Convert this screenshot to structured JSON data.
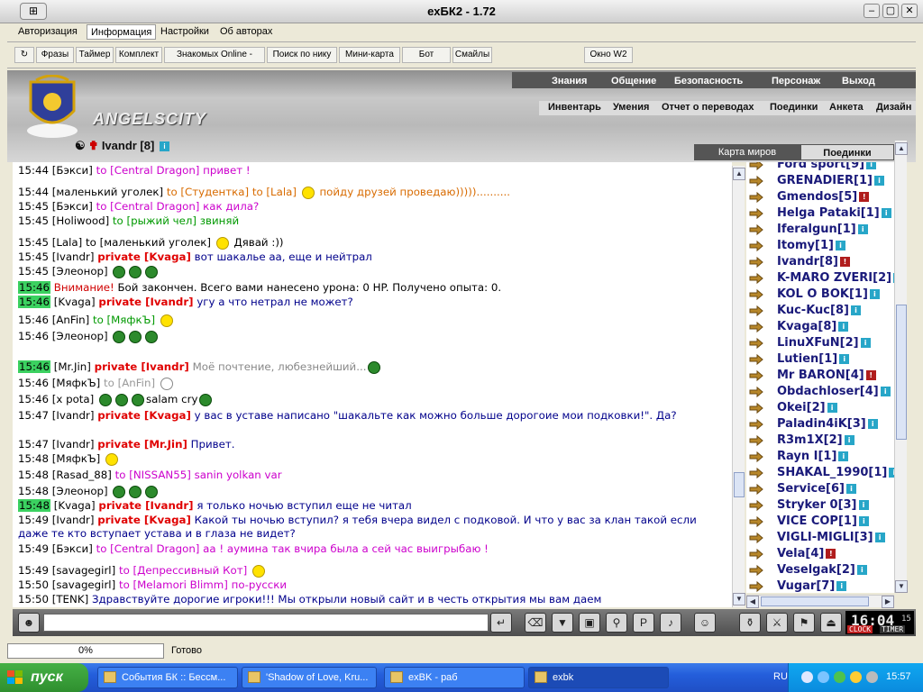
{
  "window": {
    "title": "exБК2 - 1.72"
  },
  "menu": [
    "Авторизация",
    "Информация",
    "Настройки",
    "Об авторах"
  ],
  "toolbar": [
    "Фразы",
    "Таймер",
    "Комплект",
    "Знакомых Online -",
    "Поиск по нику",
    "Мини-карта",
    "Бот",
    "Смайлы",
    "Окно W2"
  ],
  "banner": {
    "city": "ANGELSCITY",
    "nav_top": [
      "Знания",
      "Общение",
      "Безопасность",
      "Персонаж",
      "Выход"
    ],
    "nav_sub": [
      "Инвентарь",
      "Умения",
      "Отчет о переводах",
      "Поединки",
      "Анкета",
      "Дизайн"
    ],
    "character": "Ivandr [8]",
    "map_button": "Карта миров",
    "fights_button": "Поединки"
  },
  "chat": [
    {
      "time": "15:44",
      "hl": false,
      "from": "[Бэкси]",
      "to": "to [Central Dragon]",
      "cls": "to",
      "msg": "привет !",
      "mcls": "msg-pink"
    },
    {
      "time": "15:44",
      "hl": false,
      "from": "[маленький уголек]",
      "to": "to [Студентка] to [Lala]",
      "cls": "to2",
      "msg": "пойду друзей проведаю)))))..........",
      "mcls": "msg-orange"
    },
    {
      "time": "15:45",
      "hl": false,
      "from": "[Бэкси]",
      "to": "to [Central Dragon]",
      "cls": "to",
      "msg": "как дила?",
      "mcls": "msg-pink"
    },
    {
      "time": "15:45",
      "hl": false,
      "from": "[Holiwood]",
      "to": "to [рыжий чел]",
      "cls": "tg",
      "msg": "звиняй",
      "mcls": "msg-green"
    },
    {
      "time": "15:45",
      "hl": false,
      "from": "[Lala]",
      "to": "to [маленький уголек]",
      "cls": "n",
      "msg": "Дявай :))",
      "mcls": "n"
    },
    {
      "time": "15:45",
      "hl": false,
      "from": "[Ivandr]",
      "to": "private [Kvaga]",
      "cls": "pv",
      "msg": "вот шакалье аа, еще и нейтрал",
      "mcls": "msg-blue"
    },
    {
      "time": "15:45",
      "hl": false,
      "from": "[Элеонор]",
      "to": "",
      "cls": "n",
      "msg": "",
      "mcls": "n"
    },
    {
      "time": "15:46",
      "hl": true,
      "from": "",
      "to": "",
      "cls": "n",
      "msg": "Бой закончен. Всего вами нанесено урона: 0 HP. Получено опыта: 0.",
      "sys": "Внимание!",
      "mcls": "n"
    },
    {
      "time": "15:46",
      "hl": true,
      "from": "[Kvaga]",
      "to": "private [Ivandr]",
      "cls": "pv",
      "msg": "угу а что нетрал не может?",
      "mcls": "msg-blue"
    },
    {
      "time": "15:46",
      "hl": false,
      "from": "[AnFin]",
      "to": "to [МяфкЪ]",
      "cls": "tg",
      "msg": "",
      "mcls": "n"
    },
    {
      "time": "15:46",
      "hl": false,
      "from": "[Элеонор]",
      "to": "",
      "cls": "n",
      "msg": "",
      "mcls": "n"
    },
    {
      "time": "15:46",
      "hl": true,
      "from": "[Mr.Jin]",
      "to": "private [Ivandr]",
      "cls": "pv",
      "msg": "Моё почтение, любезнейший...",
      "mcls": "msg-gray"
    },
    {
      "time": "15:46",
      "hl": false,
      "from": "[МяфкЪ]",
      "to": "to [AnFin]",
      "cls": "tgray",
      "msg": "",
      "mcls": "n"
    },
    {
      "time": "15:46",
      "hl": false,
      "from": "[x pota]",
      "to": "",
      "cls": "n",
      "msg": "salam   cry",
      "mcls": "n"
    },
    {
      "time": "15:47",
      "hl": false,
      "from": "[Ivandr]",
      "to": "private [Kvaga]",
      "cls": "pv",
      "msg": "у вас в уставе написано \"шакальте как можно больше дорогоие мои подковки!\". Да?",
      "mcls": "msg-blue"
    },
    {
      "time": "15:47",
      "hl": false,
      "from": "[Ivandr]",
      "to": "private [Mr.Jin]",
      "cls": "pv",
      "msg": "Привет.",
      "mcls": "msg-blue"
    },
    {
      "time": "15:48",
      "hl": false,
      "from": "[МяфкЪ]",
      "to": "",
      "cls": "n",
      "msg": "",
      "mcls": "n"
    },
    {
      "time": "15:48",
      "hl": false,
      "from": "[Rasad_88]",
      "to": "to [NISSAN55]",
      "cls": "to",
      "msg": "sanin yolkan var",
      "mcls": "msg-pink"
    },
    {
      "time": "15:48",
      "hl": false,
      "from": "[Элеонор]",
      "to": "",
      "cls": "n",
      "msg": "",
      "mcls": "n"
    },
    {
      "time": "15:48",
      "hl": true,
      "from": "[Kvaga]",
      "to": "private [Ivandr]",
      "cls": "pv",
      "msg": "я только ночью вступил еще не читал",
      "mcls": "msg-blue"
    },
    {
      "time": "15:49",
      "hl": false,
      "from": "[Ivandr]",
      "to": "private [Kvaga]",
      "cls": "pv",
      "msg": "Какой ты ночью вступил? я тебя вчера видел с подковой. И что у вас за клан такой если даже те кто вступает устава и в глаза не видет?",
      "mcls": "msg-blue"
    },
    {
      "time": "15:49",
      "hl": false,
      "from": "[Бэкси]",
      "to": "to [Central Dragon]",
      "cls": "to",
      "msg": "аа ! аумина так вчира была а сей час выигрыбаю !",
      "mcls": "msg-pink"
    },
    {
      "time": "15:49",
      "hl": false,
      "from": "[savagegirl]",
      "to": "to [Депрессивный Кот]",
      "cls": "to",
      "msg": "",
      "mcls": "n"
    },
    {
      "time": "15:50",
      "hl": false,
      "from": "[savagegirl]",
      "to": "to [Melamori Blimm]",
      "cls": "to",
      "msg": "по-русски",
      "mcls": "msg-pink"
    },
    {
      "time": "15:50",
      "hl": false,
      "from": "[TENK]",
      "to": "",
      "cls": "n",
      "msg": "Здравствуйте дорогие игроки!!! Мы открыли новый сайт и в честь открытия мы вам даем",
      "mcls": "msg-blue"
    }
  ],
  "users": [
    {
      "name": "Ford sport",
      "lvl": "[9]",
      "info": "i"
    },
    {
      "name": "GRENADIER",
      "lvl": "[1]",
      "info": "i"
    },
    {
      "name": "Gmendos",
      "lvl": "[5]",
      "info": "!"
    },
    {
      "name": "Helga Pataki",
      "lvl": "[1]",
      "info": "i"
    },
    {
      "name": "Iferalgun",
      "lvl": "[1]",
      "info": "i"
    },
    {
      "name": "Itomy",
      "lvl": "[1]",
      "info": "i"
    },
    {
      "name": "Ivandr",
      "lvl": "[8]",
      "info": "!"
    },
    {
      "name": "K-MARO ZVERI",
      "lvl": "[2]",
      "info": "i"
    },
    {
      "name": "KOL O BOK",
      "lvl": "[1]",
      "info": "i"
    },
    {
      "name": "Kuc-Kuc",
      "lvl": "[8]",
      "info": "i"
    },
    {
      "name": "Kvaga",
      "lvl": "[8]",
      "info": "i"
    },
    {
      "name": "LinuXFuN",
      "lvl": "[2]",
      "info": "i"
    },
    {
      "name": "Lutien",
      "lvl": "[1]",
      "info": "i"
    },
    {
      "name": "Mr BARON",
      "lvl": "[4]",
      "info": "!"
    },
    {
      "name": "Obdachloser",
      "lvl": "[4]",
      "info": "i"
    },
    {
      "name": "Okei",
      "lvl": "[2]",
      "info": "i"
    },
    {
      "name": "Paladin4iK",
      "lvl": "[3]",
      "info": "i"
    },
    {
      "name": "R3m1X",
      "lvl": "[2]",
      "info": "i"
    },
    {
      "name": "Rayn I",
      "lvl": "[1]",
      "info": "i"
    },
    {
      "name": "SHAKAL_1990",
      "lvl": "[1]",
      "info": "i"
    },
    {
      "name": "Service",
      "lvl": "[6]",
      "info": "i"
    },
    {
      "name": "Stryker 0",
      "lvl": "[3]",
      "info": "i"
    },
    {
      "name": "VICE COP",
      "lvl": "[1]",
      "info": "i"
    },
    {
      "name": "VIGLI-MIGLI",
      "lvl": "[3]",
      "info": "i"
    },
    {
      "name": "Vela",
      "lvl": "[4]",
      "info": "!"
    },
    {
      "name": "Veselgak",
      "lvl": "[2]",
      "info": "i"
    },
    {
      "name": "Vugar",
      "lvl": "[7]",
      "info": "i"
    }
  ],
  "clock": {
    "time": "16:04",
    "sec": "15",
    "label_clock": "CLOCK",
    "label_timer": "TIMER"
  },
  "status": {
    "progress": "0%",
    "text": "Готово"
  },
  "taskbar": {
    "start": "пуск",
    "tasks": [
      "События БК :: Бессм...",
      "'Shadow of Love, Kru...",
      "exBK - раб",
      "exbk"
    ],
    "lang": "RU",
    "time": "15:57"
  },
  "colors": {
    "private": "#e00000",
    "to": "#cc00cc",
    "highlight_time": "#3bd160",
    "message": "#00008b"
  }
}
